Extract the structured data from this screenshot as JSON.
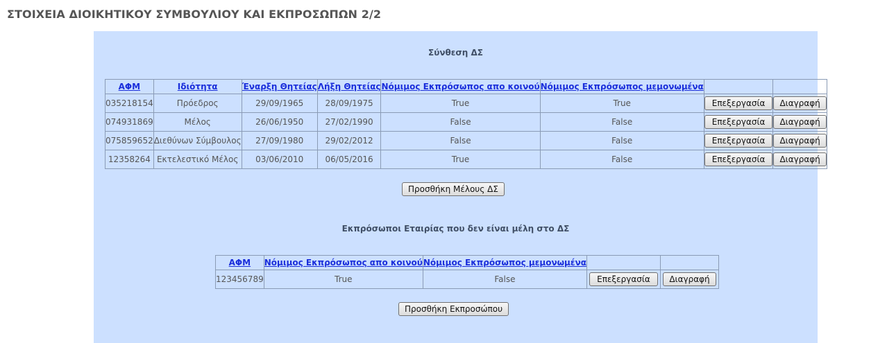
{
  "page": {
    "title": "ΣΤΟΙΧΕΙΑ ΔΙΟΙΚΗΤΙΚΟΥ ΣΥΜΒΟΥΛΙΟΥ ΚΑΙ ΕΚΠΡΟΣΩΠΩΝ 2/2"
  },
  "board": {
    "title": "Σύνθεση ΔΣ",
    "headers": {
      "afm": "ΑΦΜ",
      "role": "Ιδιότητα",
      "start": "Έναρξη Θητείας",
      "end": "Λήξη Θητείας",
      "joint": "Νόμιμος Εκπρόσωπος απο κοινού",
      "single": "Νόμιμος Εκπρόσωπος μεμονωμένα"
    },
    "rows": [
      {
        "afm": "035218154",
        "role": "Πρόεδρος",
        "start": "29/09/1965",
        "end": "28/09/1975",
        "joint": "True",
        "single": "True",
        "edit": "Επεξεργασία",
        "delete": "Διαγραφή"
      },
      {
        "afm": "074931869",
        "role": "Μέλος",
        "start": "26/06/1950",
        "end": "27/02/1990",
        "joint": "False",
        "single": "False",
        "edit": "Επεξεργασία",
        "delete": "Διαγραφή"
      },
      {
        "afm": "075859652",
        "role": "Διεθύνων Σύμβουλος",
        "start": "27/09/1980",
        "end": "29/02/2012",
        "joint": "False",
        "single": "False",
        "edit": "Επεξεργασία",
        "delete": "Διαγραφή"
      },
      {
        "afm": "12358264",
        "role": "Εκτελεστικό Μέλος",
        "start": "03/06/2010",
        "end": "06/05/2016",
        "joint": "True",
        "single": "False",
        "edit": "Επεξεργασία",
        "delete": "Διαγραφή"
      }
    ],
    "add_label": "Προσθήκη Μέλους ΔΣ"
  },
  "reps": {
    "title": "Εκπρόσωποι Εταιρίας που δεν είναι μέλη στο ΔΣ",
    "headers": {
      "afm": "ΑΦΜ",
      "joint": "Νόμιμος Εκπρόσωπος απο κοινού",
      "single": "Νόμιμος Εκπρόσωπος μεμονωμένα"
    },
    "rows": [
      {
        "afm": "123456789",
        "joint": "True",
        "single": "False",
        "edit": "Επεξεργασία",
        "delete": "Διαγραφή"
      }
    ],
    "add_label": "Προσθήκη Εκπροσώπου"
  }
}
